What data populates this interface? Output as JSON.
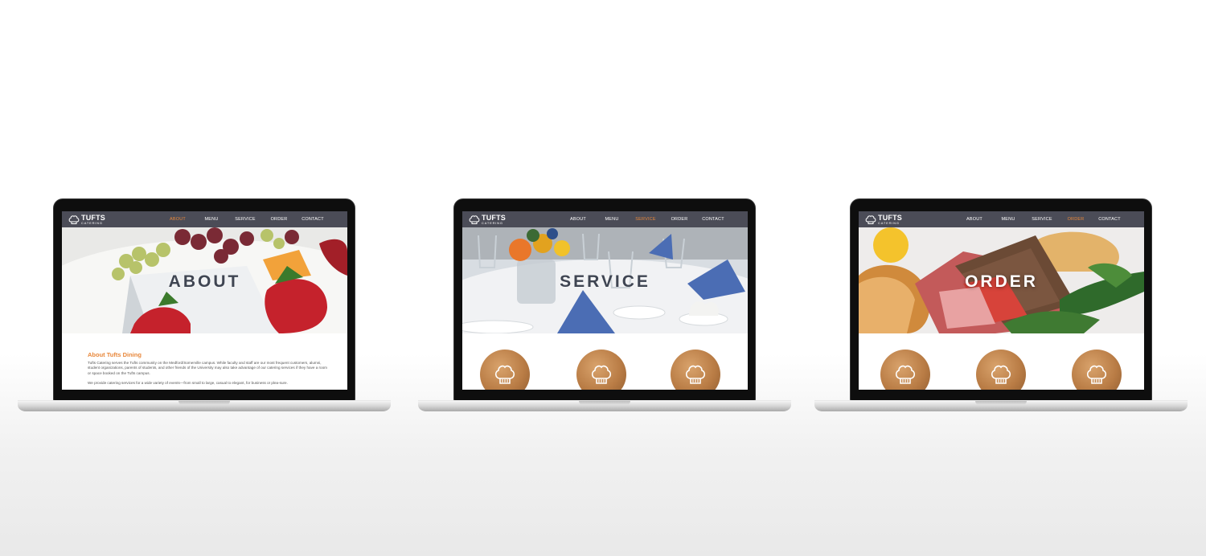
{
  "site": {
    "logo_main": "TUFTS",
    "logo_sub": "CATERING",
    "nav": [
      "ABOUT",
      "MENU",
      "SERVICE",
      "ORDER",
      "CONTACT"
    ],
    "accent_color": "#e8873a",
    "navbar_color": "#4b4c57"
  },
  "screens": [
    {
      "hero_title": "ABOUT",
      "active_nav": "ABOUT",
      "content": {
        "heading": "About Tufts Dining",
        "paragraph_1": "Tufts Catering serves the Tufts community on the Medford/Somerville campus. While faculty and staff are our most frequent customers, alumni, student organizations, parents of students, and other friends of the University may also take advantage of our catering services if they have a room or space booked on the Tufts campus.",
        "paragraph_2": "We provide catering services for a wide variety of events—from small to large, casual to elegant, for business or plea-sure."
      }
    },
    {
      "hero_title": "SERVICE",
      "active_nav": "SERVICE",
      "circles": [
        "chef-hat-icon",
        "chef-hat-icon",
        "chef-hat-icon"
      ]
    },
    {
      "hero_title": "ORDER",
      "active_nav": "ORDER",
      "circles": [
        "chef-hat-icon",
        "chef-hat-icon",
        "chef-hat-icon"
      ]
    }
  ]
}
